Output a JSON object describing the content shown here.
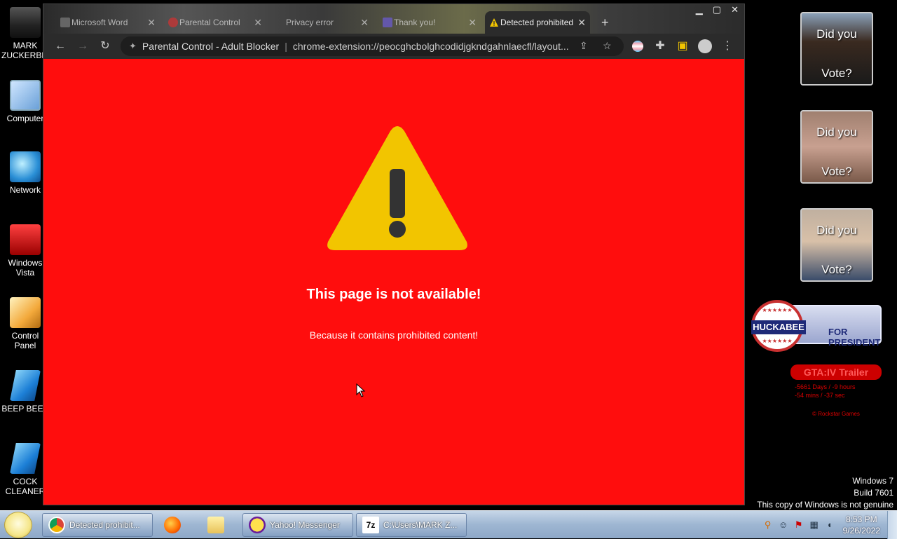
{
  "desktop_icons": [
    {
      "label": "MARK ZUCKERBERG",
      "icon": "person-icon"
    },
    {
      "label": "Computer",
      "icon": "computer-icon"
    },
    {
      "label": "Network",
      "icon": "network-icon"
    },
    {
      "label": "Windows Vista",
      "icon": "recycle-bin-icon"
    },
    {
      "label": "Control Panel",
      "icon": "control-panel-icon"
    },
    {
      "label": "BEEP BEEP",
      "icon": "app-icon"
    },
    {
      "label": "COCK CLEANER",
      "icon": "app-icon"
    }
  ],
  "browser": {
    "tabs": [
      {
        "title": "Microsoft Word",
        "icon": "word-icon",
        "close": "✕"
      },
      {
        "title": "Parental Control",
        "icon": "shield-icon",
        "close": "✕"
      },
      {
        "title": "Privacy error",
        "icon": "warning-icon",
        "close": "✕"
      },
      {
        "title": "Thank you!",
        "icon": "form-icon",
        "close": "✕"
      },
      {
        "title": "Detected prohibited",
        "icon": "warning-icon",
        "close": "✕",
        "active": true
      }
    ],
    "new_tab": "+",
    "omnibox": {
      "site_name": "Parental Control - Adult Blocker",
      "separator": "|",
      "url": "chrome-extension://peocghcbolghcodidjgkndgahnlaecfl/layout..."
    },
    "page": {
      "background": "#ff0d0d",
      "warning_color": "#f2c500",
      "title": "This page is not available!",
      "subtitle": "Because it contains prohibited content!"
    }
  },
  "gadgets": {
    "vote_cards": [
      {
        "top_text": "Did you",
        "bottom_text": "Vote?"
      },
      {
        "top_text": "Did you",
        "bottom_text": "Vote?"
      },
      {
        "top_text": "Did you",
        "bottom_text": "Vote?"
      }
    ],
    "huckabee": {
      "stars": "★★★★★★",
      "name": "HUCKABEE",
      "tagline": "FOR PRESIDENT"
    },
    "gta": {
      "title": "GTA:IV Trailer",
      "countdown_line1": "-5661 Days / -9 hours",
      "countdown_line2": "-54 mins / -37 sec",
      "copyright": "© Rockstar Games"
    }
  },
  "watermark": {
    "line1": "Windows 7",
    "line2": "Build 7601",
    "line3": "This copy of Windows is not genuine"
  },
  "taskbar": {
    "items": [
      {
        "label": "Detected prohibit...",
        "icon": "chrome-icon"
      },
      {
        "label": "",
        "icon": "firefox-icon"
      },
      {
        "label": "",
        "icon": "folder-icon"
      },
      {
        "label": "Yahoo! Messenger",
        "icon": "yahoo-icon"
      },
      {
        "label": "C:\\Users\\MARK Z...",
        "icon": "7zip-icon"
      }
    ],
    "tray": {
      "time": "8:53 PM",
      "date": "9/26/2022"
    }
  }
}
